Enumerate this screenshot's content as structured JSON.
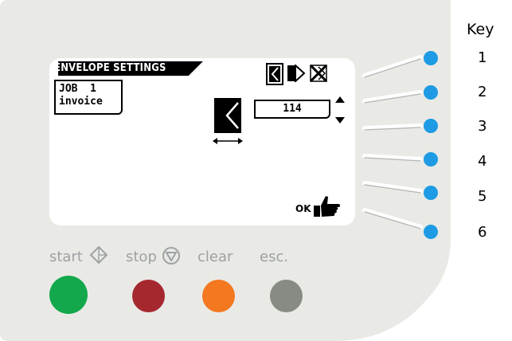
{
  "screen": {
    "title": "ENVELOPE SETTINGS",
    "job": {
      "line1": "JOB  1",
      "line2": "invoice"
    },
    "value": "114",
    "ok_label": "OK",
    "icons": [
      "envelope-flap-left-icon",
      "envelope-flap-right-icon",
      "envelope-crossed-icon",
      "envelope-width-icon",
      "arrow-up-icon",
      "arrow-down-icon",
      "hand-pointer-icon"
    ]
  },
  "controls": {
    "start_label": "start",
    "stop_label": "stop",
    "clear_label": "clear",
    "esc_label": "esc."
  },
  "buttons": {
    "start_color": "#13a84b",
    "stop_color": "#a5282f",
    "clear_color": "#f47820",
    "esc_color": "#868c84"
  },
  "key": {
    "title": "Key",
    "items": [
      "1",
      "2",
      "3",
      "4",
      "5",
      "6"
    ],
    "led_color": "#1e9be4"
  },
  "panel_color": "#e9eae6"
}
